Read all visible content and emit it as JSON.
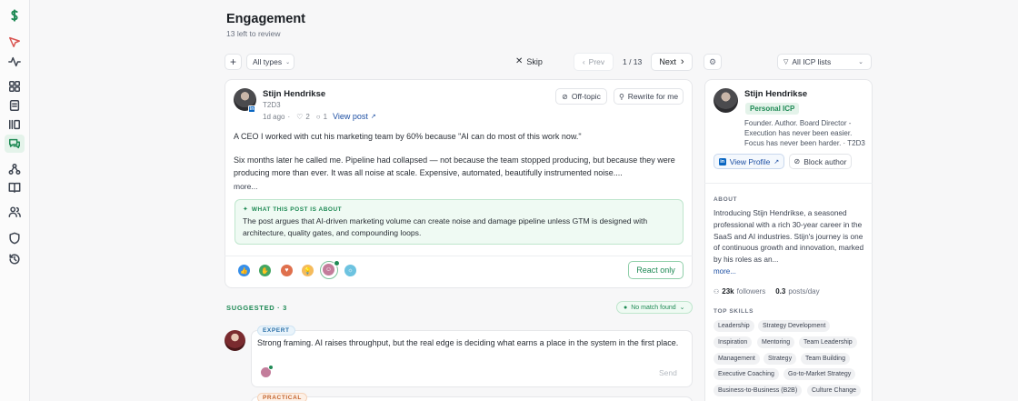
{
  "page": {
    "title": "Engagement",
    "subtitle": "13 left to review"
  },
  "toolbar": {
    "add_label": "+",
    "filter_label": "All types",
    "skip_label": "Skip",
    "prev_label": "Prev",
    "counter": "1 / 13",
    "next_label": "Next",
    "icp_label": "All ICP lists"
  },
  "post": {
    "author": "Stijn Hendrikse",
    "handle": "T2D3",
    "time": "1d ago",
    "likes": "2",
    "comments": "1",
    "view_post": "View post",
    "off_topic": "Off-topic",
    "rewrite": "Rewrite for me",
    "para1": "A CEO I worked with cut his marketing team by 60% because \"AI can do most of this work now.\"",
    "para2": "Six months later he called me. Pipeline had collapsed — not because the team stopped producing, but because they were producing more than ever. It was all noise at scale. Expensive, automated, beautifully instrumented noise....",
    "more": "more...",
    "about_heading": "WHAT THIS POST IS ABOUT",
    "about_text": "The post argues that AI-driven marketing volume can create noise and damage pipeline unless GTM is designed with architecture, quality gates, and compounding loops.",
    "react_only": "React only"
  },
  "suggested": {
    "label": "SUGGESTED · 3",
    "match": "No match found",
    "items": [
      {
        "tag": "EXPERT",
        "text": "Strong framing. AI raises throughput, but the real edge is deciding what earns a place in the system in the first place.",
        "send": "Send"
      },
      {
        "tag": "PRACTICAL"
      }
    ]
  },
  "profile": {
    "name": "Stijn Hendrikse",
    "badge": "Personal ICP",
    "headline": "Founder. Author. Board Director - Execution has never been easier. Focus has never been harder. · T2D3",
    "view_profile": "View Profile",
    "block": "Block author",
    "about_heading": "ABOUT",
    "about_text": "Introducing Stijn Hendrikse, a seasoned professional with a rich 30-year career in the SaaS and AI industries. Stijn's journey is one of continuous growth and innovation, marked by his roles as an...",
    "more": "more...",
    "followers": "23k",
    "followers_label": "followers",
    "posts": "0.3",
    "posts_label": "posts/day",
    "skills_heading": "TOP SKILLS",
    "skills": [
      "Leadership",
      "Strategy Development",
      "Inspiration",
      "Mentoring",
      "Team Leadership",
      "Management",
      "Strategy",
      "Team Building",
      "Executive Coaching",
      "Go-to-Market Strategy",
      "Business-to-Business (B2B)",
      "Culture Change"
    ]
  },
  "colors": {
    "accent": "#1f8a55",
    "link": "#1d4fa3",
    "linkedin": "#0a66c2"
  }
}
